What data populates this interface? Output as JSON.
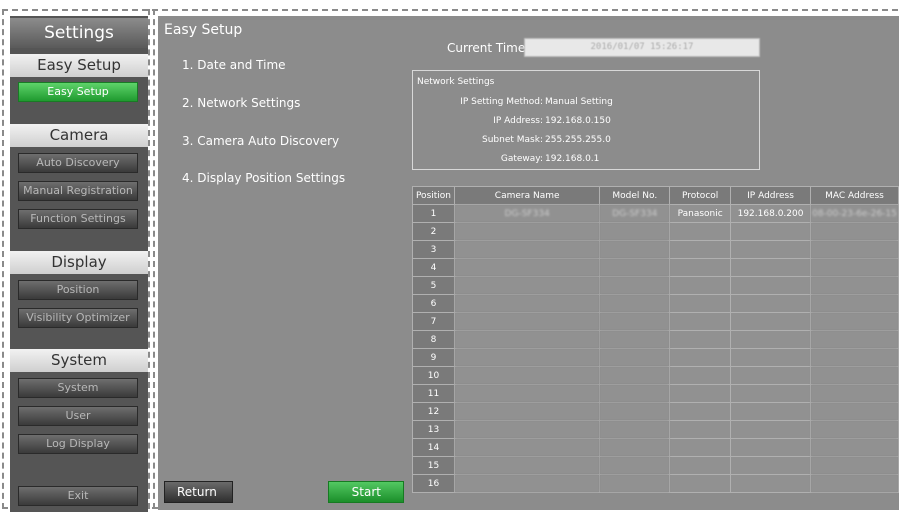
{
  "sidebar": {
    "title": "Settings",
    "sections": {
      "easy_setup": "Easy Setup",
      "camera": "Camera",
      "display": "Display",
      "system": "System"
    },
    "buttons": {
      "easy_setup": "Easy Setup",
      "auto_discovery": "Auto Discovery",
      "manual_registration": "Manual Registration",
      "function_settings": "Function Settings",
      "position": "Position",
      "visibility_optimizer": "Visibility Optimizer",
      "system": "System",
      "user": "User",
      "log_display": "Log Display",
      "exit": "Exit"
    }
  },
  "main": {
    "title": "Easy Setup",
    "steps": [
      "1. Date and Time",
      "2. Network Settings",
      "3. Camera Auto Discovery",
      "4. Display Position Settings"
    ],
    "current_time_label": "Current Time",
    "current_time_value": "2016/01/07 15:26:17",
    "network": {
      "title": "Network Settings",
      "rows": [
        {
          "label": "IP Setting Method:",
          "value": "Manual Setting"
        },
        {
          "label": "IP Address:",
          "value": "192.168.0.150"
        },
        {
          "label": "Subnet Mask:",
          "value": "255.255.255.0"
        },
        {
          "label": "Gateway:",
          "value": "192.168.0.1"
        }
      ]
    },
    "table": {
      "headers": [
        "Position",
        "Camera Name",
        "Model No.",
        "Protocol",
        "IP Address",
        "MAC Address"
      ],
      "rows": [
        {
          "pos": "1",
          "name": "DG-SF334",
          "model": "DG-SF334",
          "protocol": "Panasonic",
          "ip": "192.168.0.200",
          "mac": "08-00-23-6e-26-15"
        },
        {
          "pos": "2",
          "name": "",
          "model": "",
          "protocol": "",
          "ip": "",
          "mac": ""
        },
        {
          "pos": "3",
          "name": "",
          "model": "",
          "protocol": "",
          "ip": "",
          "mac": ""
        },
        {
          "pos": "4",
          "name": "",
          "model": "",
          "protocol": "",
          "ip": "",
          "mac": ""
        },
        {
          "pos": "5",
          "name": "",
          "model": "",
          "protocol": "",
          "ip": "",
          "mac": ""
        },
        {
          "pos": "6",
          "name": "",
          "model": "",
          "protocol": "",
          "ip": "",
          "mac": ""
        },
        {
          "pos": "7",
          "name": "",
          "model": "",
          "protocol": "",
          "ip": "",
          "mac": ""
        },
        {
          "pos": "8",
          "name": "",
          "model": "",
          "protocol": "",
          "ip": "",
          "mac": ""
        },
        {
          "pos": "9",
          "name": "",
          "model": "",
          "protocol": "",
          "ip": "",
          "mac": ""
        },
        {
          "pos": "10",
          "name": "",
          "model": "",
          "protocol": "",
          "ip": "",
          "mac": ""
        },
        {
          "pos": "11",
          "name": "",
          "model": "",
          "protocol": "",
          "ip": "",
          "mac": ""
        },
        {
          "pos": "12",
          "name": "",
          "model": "",
          "protocol": "",
          "ip": "",
          "mac": ""
        },
        {
          "pos": "13",
          "name": "",
          "model": "",
          "protocol": "",
          "ip": "",
          "mac": ""
        },
        {
          "pos": "14",
          "name": "",
          "model": "",
          "protocol": "",
          "ip": "",
          "mac": ""
        },
        {
          "pos": "15",
          "name": "",
          "model": "",
          "protocol": "",
          "ip": "",
          "mac": ""
        },
        {
          "pos": "16",
          "name": "",
          "model": "",
          "protocol": "",
          "ip": "",
          "mac": ""
        }
      ]
    },
    "return_label": "Return",
    "start_label": "Start"
  },
  "colors": {
    "accent_green": "#1f9a2f",
    "panel_gray": "#8c8c8c",
    "sidebar_dark": "#555555"
  }
}
